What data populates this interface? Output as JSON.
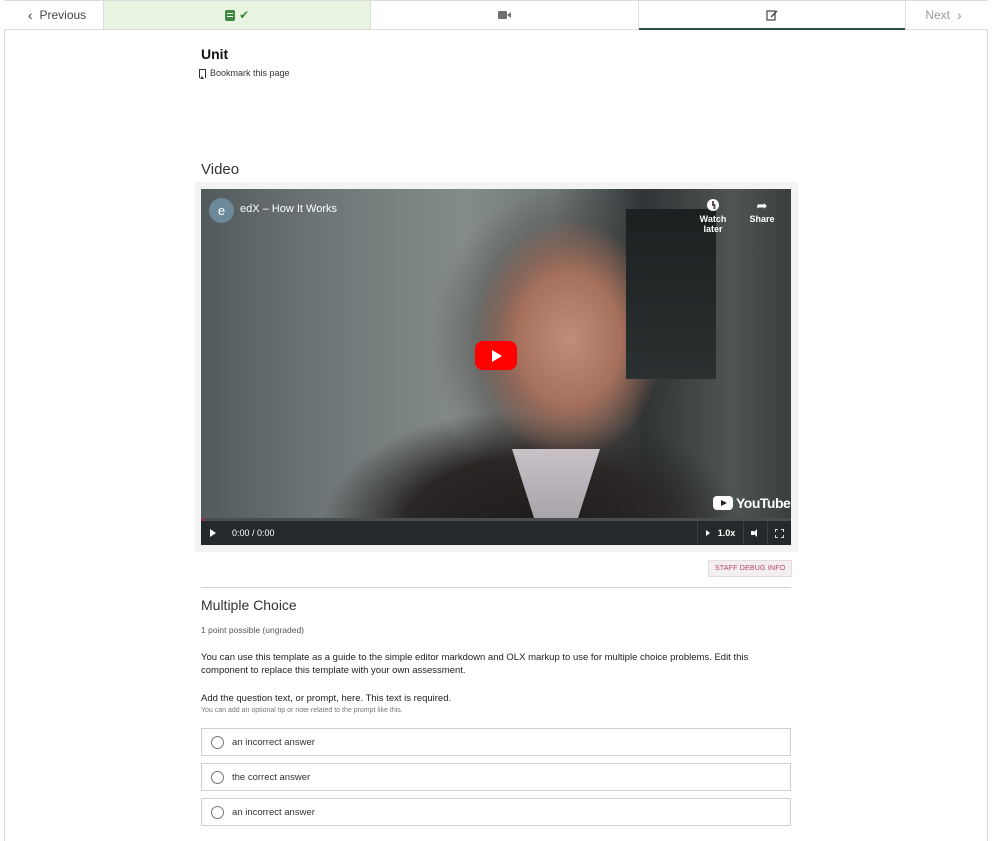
{
  "nav": {
    "previous_label": "Previous",
    "next_label": "Next",
    "tabs": [
      {
        "type": "problem",
        "icon": "problem-sheet-icon",
        "completed": true
      },
      {
        "type": "video",
        "icon": "video-camera-icon"
      },
      {
        "type": "edit",
        "icon": "edit-icon",
        "active": true
      }
    ]
  },
  "unit": {
    "title": "Unit",
    "bookmark_label": "Bookmark this page"
  },
  "video": {
    "heading": "Video",
    "channel_initial": "e",
    "title": "edX – How It Works",
    "watch_later": "Watch later",
    "share": "Share",
    "brand": "YouTube",
    "time": "0:00 / 0:00",
    "speed": "1.0x"
  },
  "staff_debug_label": "STAFF DEBUG INFO",
  "problem": {
    "title": "Multiple Choice",
    "points": "1 point possible (ungraded)",
    "description": "You can use this template as a guide to the simple editor markdown and OLX markup to use for multiple choice problems. Edit this component to replace this template with your own assessment.",
    "prompt": "Add the question text, or prompt, here. This text is required.",
    "tip": "You can add an optional tip or note related to the prompt like this.",
    "choices": [
      {
        "label": "an incorrect answer"
      },
      {
        "label": "the correct answer"
      },
      {
        "label": "an incorrect answer"
      }
    ]
  },
  "colors": {
    "completed_tab_bg": "#e9f4e3",
    "completed_icon": "#3e8a3e",
    "active_tab_underline": "#2d4c48",
    "youtube_red": "#ff0000",
    "staff_debug_text": "#b0485f"
  }
}
